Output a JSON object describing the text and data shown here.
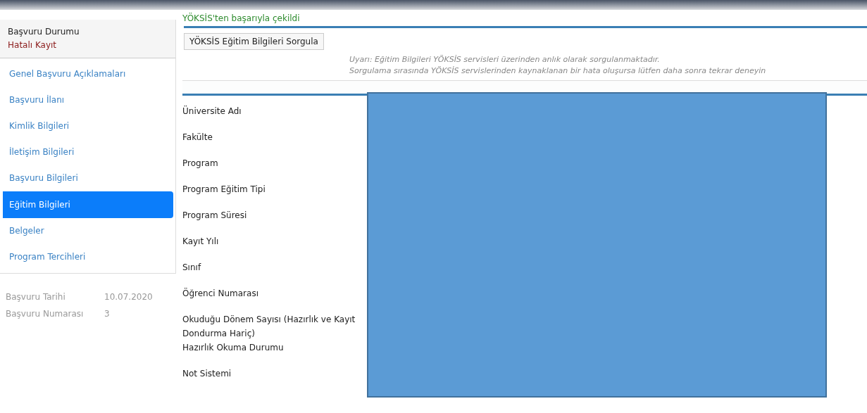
{
  "sidebar": {
    "status_label": "Başvuru Durumu",
    "status_value": "Hatalı Kayıt",
    "items": [
      {
        "label": "Genel Başvuru Açıklamaları",
        "selected": false
      },
      {
        "label": "Başvuru İlanı",
        "selected": false
      },
      {
        "label": "Kimlik Bilgileri",
        "selected": false
      },
      {
        "label": "İletişim Bilgileri",
        "selected": false
      },
      {
        "label": "Başvuru Bilgileri",
        "selected": false
      },
      {
        "label": "Eğitim Bilgileri",
        "selected": true
      },
      {
        "label": "Belgeler",
        "selected": false
      },
      {
        "label": "Program Tercihleri",
        "selected": false
      }
    ],
    "info": [
      {
        "label": "Başvuru Tarihi",
        "value": "10.07.2020"
      },
      {
        "label": "Başvuru Numarası",
        "value": "3"
      }
    ]
  },
  "main": {
    "success_message": "YÖKSİS'ten başarıyla çekildi",
    "query_button": "YÖKSİS Eğitim Bilgileri Sorgula",
    "warning_lines": [
      "Uyarı: Eğitim Bilgileri YÖKSİS servisleri üzerinden anlık olarak sorgulanmaktadır.",
      "Sorgulama sırasında YÖKSİS servislerinden kaynaklanan bir hata oluşursa lütfen daha sonra tekrar deneyin"
    ],
    "fields": [
      "Üniversite Adı",
      "Fakülte",
      "Program",
      "Program Eğitim Tipi",
      "Program Süresi",
      "Kayıt Yılı",
      "Sınıf",
      "Öğrenci Numarası",
      "Okuduğu Dönem Sayısı (Hazırlık ve Kayıt Dondurma Hariç)",
      "Hazırlık Okuma Durumu",
      "Not Sistemi"
    ]
  }
}
